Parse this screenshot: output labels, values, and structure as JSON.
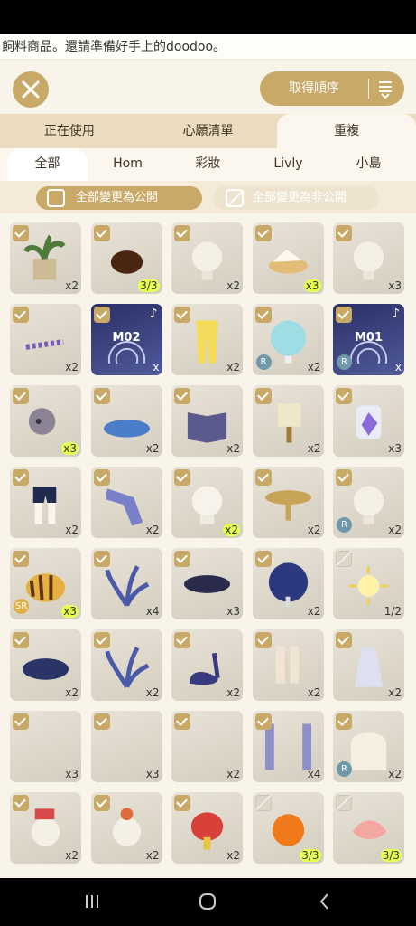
{
  "ticker": "飼料商品。還請準備好手上的doodoo。",
  "sort_label": "取得順序",
  "tabs": [
    "正在使用",
    "心願清單",
    "重複"
  ],
  "active_tab": 2,
  "subtabs": [
    "全部",
    "Hom",
    "彩妝",
    "Livly",
    "小島"
  ],
  "active_subtab": 0,
  "actions": {
    "make_public": "全部變更為公開",
    "make_private": "全部變更為非公開"
  },
  "colors": {
    "gold": "#c9a968",
    "highlight": "#e6ff50",
    "rarity_r": "#6f98a8",
    "rarity_sr": "#e0b048"
  },
  "items": [
    {
      "icon": "potted-plant-icon",
      "count": "x2",
      "checked": true
    },
    {
      "icon": "seed-icon",
      "count": "3/3",
      "checked": true,
      "hl": true
    },
    {
      "icon": "livly-head-icon",
      "count": "x2",
      "checked": true
    },
    {
      "icon": "bowl-food-icon",
      "count": "x3",
      "checked": true,
      "hl": true
    },
    {
      "icon": "livly-head-icon",
      "count": "x3",
      "checked": true
    },
    {
      "icon": "flower-petals-icon",
      "count": "x2",
      "checked": true
    },
    {
      "icon": "music-disc-icon",
      "count": "x",
      "checked": true,
      "dark": true,
      "label": "M02",
      "note": "♪"
    },
    {
      "icon": "yellow-pants-icon",
      "count": "x2",
      "checked": true
    },
    {
      "icon": "globe-lamp-icon",
      "count": "x2",
      "checked": true,
      "rarity": "R"
    },
    {
      "icon": "music-disc-icon",
      "count": "x",
      "checked": true,
      "dark": true,
      "label": "M01",
      "note": "♪",
      "rarity": "R"
    },
    {
      "icon": "livly-icon",
      "count": "x3",
      "checked": true,
      "hl": true
    },
    {
      "icon": "flower-rug-icon",
      "count": "x2",
      "checked": true
    },
    {
      "icon": "book-icon",
      "count": "x2",
      "checked": true
    },
    {
      "icon": "scroll-stand-icon",
      "count": "x2",
      "checked": true
    },
    {
      "icon": "crystal-jar-icon",
      "count": "x3",
      "checked": true
    },
    {
      "icon": "shorts-icon",
      "count": "x2",
      "checked": true
    },
    {
      "icon": "sleeve-icon",
      "count": "x2",
      "checked": true
    },
    {
      "icon": "livly-hood-icon",
      "count": "x2",
      "checked": true,
      "hl": true
    },
    {
      "icon": "pedestal-bowl-icon",
      "count": "x2",
      "checked": true
    },
    {
      "icon": "livly-head-icon",
      "count": "x2",
      "checked": true,
      "rarity": "R"
    },
    {
      "icon": "striped-creature-icon",
      "count": "x3",
      "checked": true,
      "hl": true,
      "rarity": "SR"
    },
    {
      "icon": "blue-leaves-icon",
      "count": "x4",
      "checked": true
    },
    {
      "icon": "dark-bowl-icon",
      "count": "x3",
      "checked": true
    },
    {
      "icon": "star-tree-icon",
      "count": "x2",
      "checked": true
    },
    {
      "icon": "sun-icon",
      "count": "1/2",
      "checked": false
    },
    {
      "icon": "star-rug-icon",
      "count": "x2",
      "checked": true
    },
    {
      "icon": "blue-leaves-icon",
      "count": "x2",
      "checked": true
    },
    {
      "icon": "swan-icon",
      "count": "x2",
      "checked": true
    },
    {
      "icon": "boots-icon",
      "count": "x2",
      "checked": true
    },
    {
      "icon": "dress-icon",
      "count": "x2",
      "checked": true
    },
    {
      "icon": "blank-item-icon",
      "count": "x3",
      "checked": true
    },
    {
      "icon": "blank-item-icon",
      "count": "x3",
      "checked": true
    },
    {
      "icon": "blank-item-icon",
      "count": "x2",
      "checked": true
    },
    {
      "icon": "curtain-icon",
      "count": "x4",
      "checked": true
    },
    {
      "icon": "arch-window-icon",
      "count": "x2",
      "checked": true,
      "rarity": "R"
    },
    {
      "icon": "hat-livly-icon",
      "count": "x2",
      "checked": true
    },
    {
      "icon": "flower-hat-icon",
      "count": "x2",
      "checked": true
    },
    {
      "icon": "venus-plant-icon",
      "count": "x2",
      "checked": true
    },
    {
      "icon": "orange-drop-icon",
      "count": "3/3",
      "checked": false,
      "hl": true
    },
    {
      "icon": "shrimp-icon",
      "count": "3/3",
      "checked": false,
      "hl": true
    }
  ]
}
